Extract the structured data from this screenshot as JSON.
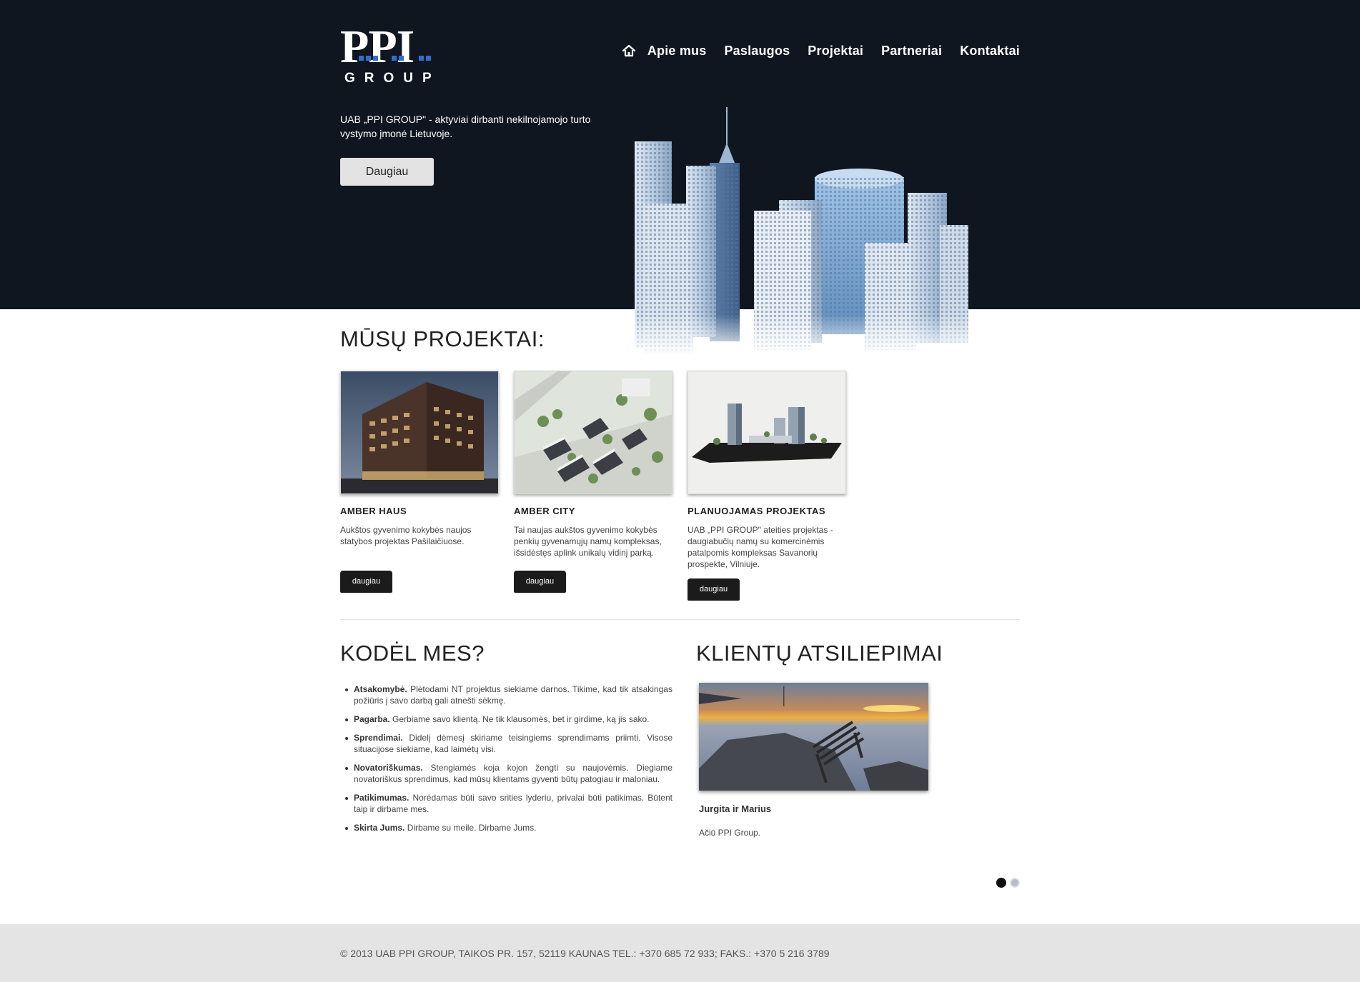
{
  "header": {
    "logo_main": "PPI",
    "logo_sub": "GROUP",
    "nav": [
      {
        "label": "Apie mus"
      },
      {
        "label": "Paslaugos"
      },
      {
        "label": "Projektai"
      },
      {
        "label": "Partneriai"
      },
      {
        "label": "Kontaktai"
      }
    ],
    "home_icon": "home-icon",
    "intro_text": "UAB „PPI GROUP\" - aktyviai dirbanti nekilnojamojo turto vystymo įmonė Lietuvoje.",
    "more_button": "Daugiau"
  },
  "projects": {
    "title": "MŪSŲ PROJEKTAI:",
    "items": [
      {
        "title": "AMBER HAUS",
        "description": "Aukštos gyvenimo kokybės naujos statybos projektas Pašilaičiuose.",
        "button": "daugiau"
      },
      {
        "title": "AMBER CITY",
        "description": "Tai naujas aukštos gyvenimo kokybės penkių gyvenamųjų namų kompleksas, išsidėstęs aplink unikalų vidinį parką.",
        "button": "daugiau"
      },
      {
        "title": "PLANUOJAMAS PROJEKTAS",
        "description": "UAB „PPI GROUP\" ateities projektas - daugiabučių namų su komercinėmis patalpomis kompleksas Savanorių prospekte, Vilniuje.",
        "button": "daugiau"
      }
    ]
  },
  "why": {
    "title": "KODĖL MES?",
    "items": [
      {
        "term": "Atsakomybė.",
        "text": "Plėtodami NT projektus siekiame darnos. Tikime, kad tik atsakingas požiūris į savo darbą gali atnešti sėkmę."
      },
      {
        "term": "Pagarba.",
        "text": "Gerbiame savo klientą. Ne tik klausomės, bet ir girdime, ką jis sako."
      },
      {
        "term": "Sprendimai.",
        "text": "Didelį dėmesį skiriame teisingiems sprendimams priimti. Visose situacijose siekiame, kad laimėtų visi."
      },
      {
        "term": "Novatoriškumas.",
        "text": "Stengiamės koja kojon žengti su naujovėmis. Diegiame novatoriškus sprendimus, kad mūsų klientams gyventi būtų patogiau ir maloniau."
      },
      {
        "term": "Patikimumas.",
        "text": "Norėdamas būti savo srities lyderiu, privalai būti patikimas. Būtent taip ir dirbame mes."
      },
      {
        "term": "Skirta Jums.",
        "text": "Dirbame su meile. Dirbame Jums."
      }
    ]
  },
  "testimonials": {
    "title": "KLIENTŲ ATSILIEPIMAI",
    "name": "Jurgita ir Marius",
    "text": "Ačiū PPI Group.",
    "slide_count": 2,
    "active_slide": 1
  },
  "footer": {
    "text": "© 2013 UAB PPI GROUP, TAIKOS PR. 157, 52119 KAUNAS TEL.: +370 685 72 933; FAKS.: +370 5 216 3789"
  },
  "colors": {
    "header_bg": "#0f1620",
    "logo_accent": "#2d6fd0",
    "button_dark": "#1b1b1b",
    "button_light": "#e3e3e3",
    "footer_bg": "#e4e4e4"
  }
}
